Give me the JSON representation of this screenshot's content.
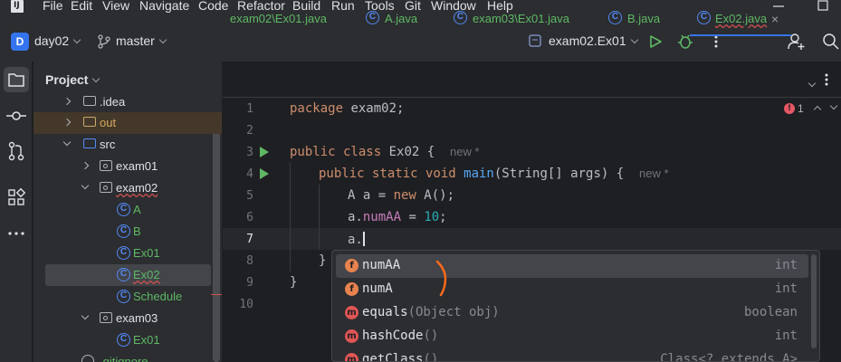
{
  "menu": [
    "File",
    "Edit",
    "View",
    "Navigate",
    "Code",
    "Refactor",
    "Build",
    "Run",
    "Tools",
    "Git",
    "Window",
    "Help"
  ],
  "logo_text": "IJ",
  "title": {
    "project_badge": "D",
    "project": "day02",
    "branch": "master",
    "run_config": "exam02.Ex01"
  },
  "project_panel": {
    "title": "Project",
    "tree": [
      {
        "label": ".idea",
        "kind": "folder"
      },
      {
        "label": "out",
        "kind": "folder"
      },
      {
        "label": "src",
        "kind": "folder"
      },
      {
        "label": "exam01",
        "kind": "package"
      },
      {
        "label": "exam02",
        "kind": "package"
      },
      {
        "label": "A",
        "kind": "class"
      },
      {
        "label": "B",
        "kind": "class"
      },
      {
        "label": "Ex01",
        "kind": "class"
      },
      {
        "label": "Ex02",
        "kind": "class"
      },
      {
        "label": "Schedule",
        "kind": "class"
      },
      {
        "label": "exam03",
        "kind": "package"
      },
      {
        "label": "Ex01",
        "kind": "class"
      },
      {
        "label": ".gitignore",
        "kind": "file"
      }
    ]
  },
  "tabs": [
    "exam02\\Ex01.java",
    "A.java",
    "exam03\\Ex01.java",
    "B.java",
    "Ex02.java"
  ],
  "active_tab": "Ex02.java",
  "line_numbers": [
    "1",
    "2",
    "3",
    "4",
    "5",
    "6",
    "7",
    "8",
    "9",
    "10"
  ],
  "code": {
    "l1a": "package",
    "l1b": " exam02;",
    "l3a": "public class",
    "l3b": " Ex02 {",
    "l3c": "new *",
    "l4a": "public static void",
    "l4b": " main",
    "l4c": "(String[] args) {",
    "l4d": "new *",
    "l5a": "A a = ",
    "l5b": "new",
    "l5c": " A();",
    "l6a": "a.",
    "l6b": "numAA",
    "l6c": " = ",
    "l6d": "10",
    "l6e": ";",
    "l7": "a.",
    "l8": "}",
    "l9": "}"
  },
  "problems": {
    "count": "1",
    "icon": "error-icon"
  },
  "completion": [
    {
      "icon": "f",
      "name": "numAA",
      "type": "int"
    },
    {
      "icon": "f",
      "name": "numA",
      "type": "int"
    },
    {
      "icon": "m",
      "name": "equals",
      "params": "(Object obj)",
      "type": "boolean"
    },
    {
      "icon": "m",
      "name": "hashCode",
      "params": "()",
      "type": "int"
    },
    {
      "icon": "m",
      "name": "getClass",
      "params": "()",
      "type": "Class<? extends A>"
    }
  ],
  "colors": {
    "accent": "#3574f0",
    "run": "#5fb865",
    "field_icon": "#e8834f",
    "method_icon": "#e05555"
  }
}
